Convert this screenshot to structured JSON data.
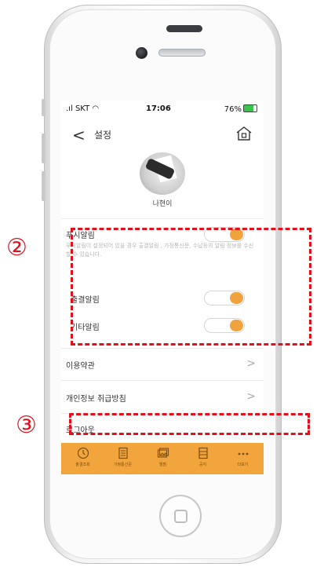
{
  "status_bar": {
    "carrier": "SKT",
    "time": "17:06",
    "battery": "76%"
  },
  "header": {
    "title": "설정"
  },
  "profile": {
    "name": "나현이"
  },
  "push": {
    "label": "푸시알림",
    "description": "푸시알림이 설정되어 있을 경우 출결알림 , 가정통신문, 수납등의 알림 정보를 수신할 수 있습니다.",
    "on": true
  },
  "attendance_alert": {
    "label": "출결알림",
    "on": true
  },
  "other_alert": {
    "label": "기타알림",
    "on": true
  },
  "menu": {
    "terms": "이용약관",
    "privacy": "개인정보 취급방침",
    "logout": "로그아웃"
  },
  "tabbar": [
    {
      "label": "출결조회",
      "icon": "clock-icon"
    },
    {
      "label": "가정통신문",
      "icon": "document-icon"
    },
    {
      "label": "앨범",
      "icon": "album-icon"
    },
    {
      "label": "공지",
      "icon": "notice-icon"
    },
    {
      "label": "더보기",
      "icon": "more-icon"
    }
  ],
  "annotations": {
    "two": "②",
    "three": "③"
  },
  "colors": {
    "accent": "#f2a53c",
    "annotation": "#e3101b"
  }
}
